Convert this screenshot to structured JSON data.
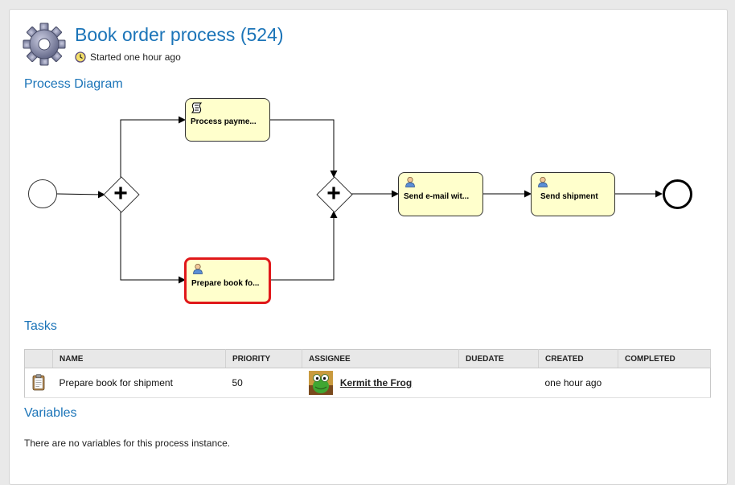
{
  "header": {
    "title": "Book order process (524)",
    "started": "Started one hour ago"
  },
  "sections": {
    "diagram": "Process Diagram",
    "tasks": "Tasks",
    "variables": "Variables"
  },
  "diagram": {
    "tasks": [
      {
        "label": "Process payme...",
        "icon": "script-icon",
        "active": false
      },
      {
        "label": "Prepare book fo...",
        "icon": "user-task-icon",
        "active": true
      },
      {
        "label": "Send e-mail wit...",
        "icon": "user-task-icon",
        "active": false
      },
      {
        "label": "Send shipment",
        "icon": "user-task-icon",
        "active": false
      }
    ],
    "gateways": [
      "parallel-split",
      "parallel-join"
    ]
  },
  "tasks_table": {
    "columns": [
      "NAME",
      "PRIORITY",
      "ASSIGNEE",
      "DUEDATE",
      "CREATED",
      "COMPLETED"
    ],
    "rows": [
      {
        "name": "Prepare book for shipment",
        "priority": "50",
        "assignee": "Kermit the Frog",
        "duedate": "",
        "created": "one hour ago",
        "completed": ""
      }
    ]
  },
  "variables": {
    "empty_message": "There are no variables for this process instance."
  },
  "colors": {
    "accent": "#1b74b8",
    "task_fill": "#ffffcc",
    "active_border": "#e0181a"
  }
}
